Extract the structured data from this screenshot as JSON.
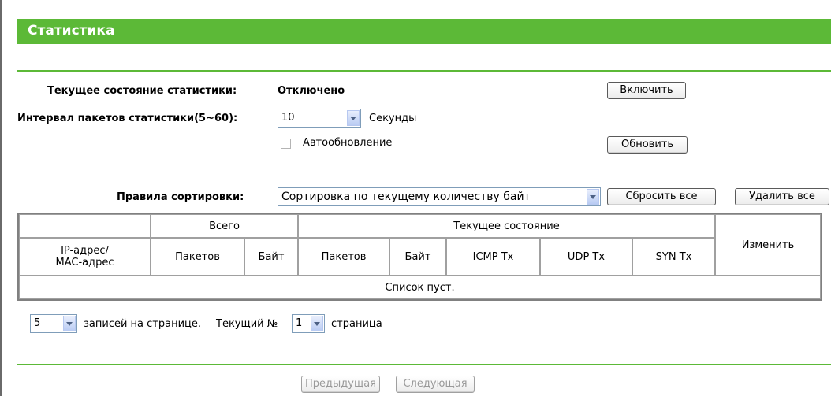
{
  "page": {
    "title": "Статистика"
  },
  "status": {
    "label": "Текущее состояние статистики:",
    "value": "Отключено",
    "enable_button": "Включить"
  },
  "interval": {
    "label": "Интервал пакетов статистики(5~60):",
    "value": "10",
    "unit": "Секунды"
  },
  "auto_refresh": {
    "label": "Автообновление",
    "checked": false,
    "refresh_button": "Обновить"
  },
  "sort": {
    "label": "Правила сортировки:",
    "value": "Сортировка по текущему количеству байт",
    "reset_all_button": "Сбросить все",
    "delete_all_button": "Удалить все"
  },
  "table": {
    "group_total": "Всего",
    "group_current": "Текущее состояние",
    "col_edit": "Изменить",
    "col_ip_mac": "IP-адрес/\nMAC-адрес",
    "col_total_packets": "Пакетов",
    "col_total_bytes": "Байт",
    "col_cur_packets": "Пакетов",
    "col_cur_bytes": "Байт",
    "col_icmp": "ICMP Tx",
    "col_udp": "UDP Tx",
    "col_syn": "SYN Tx",
    "empty_text": "Список пуст."
  },
  "pagination": {
    "per_page_value": "5",
    "per_page_label": "записей на странице.",
    "current_label": "Текущий №",
    "page_value": "1",
    "page_label": "страница",
    "prev_button": "Предыдущая",
    "next_button": "Следующая"
  },
  "colors": {
    "accent": "#5cb937"
  }
}
